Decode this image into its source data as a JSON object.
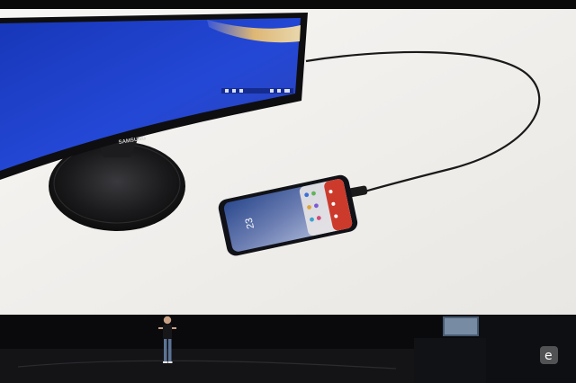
{
  "scene": {
    "monitor_brand": "SAMSUNG",
    "phone_clock": "23",
    "watermark_glyph": "e"
  },
  "colors": {
    "screen_bg": "#f3f2ef",
    "desktop_blue": "#1d3fcf",
    "stage": "#0b0b0c",
    "accent_red": "#cc3a2c"
  }
}
